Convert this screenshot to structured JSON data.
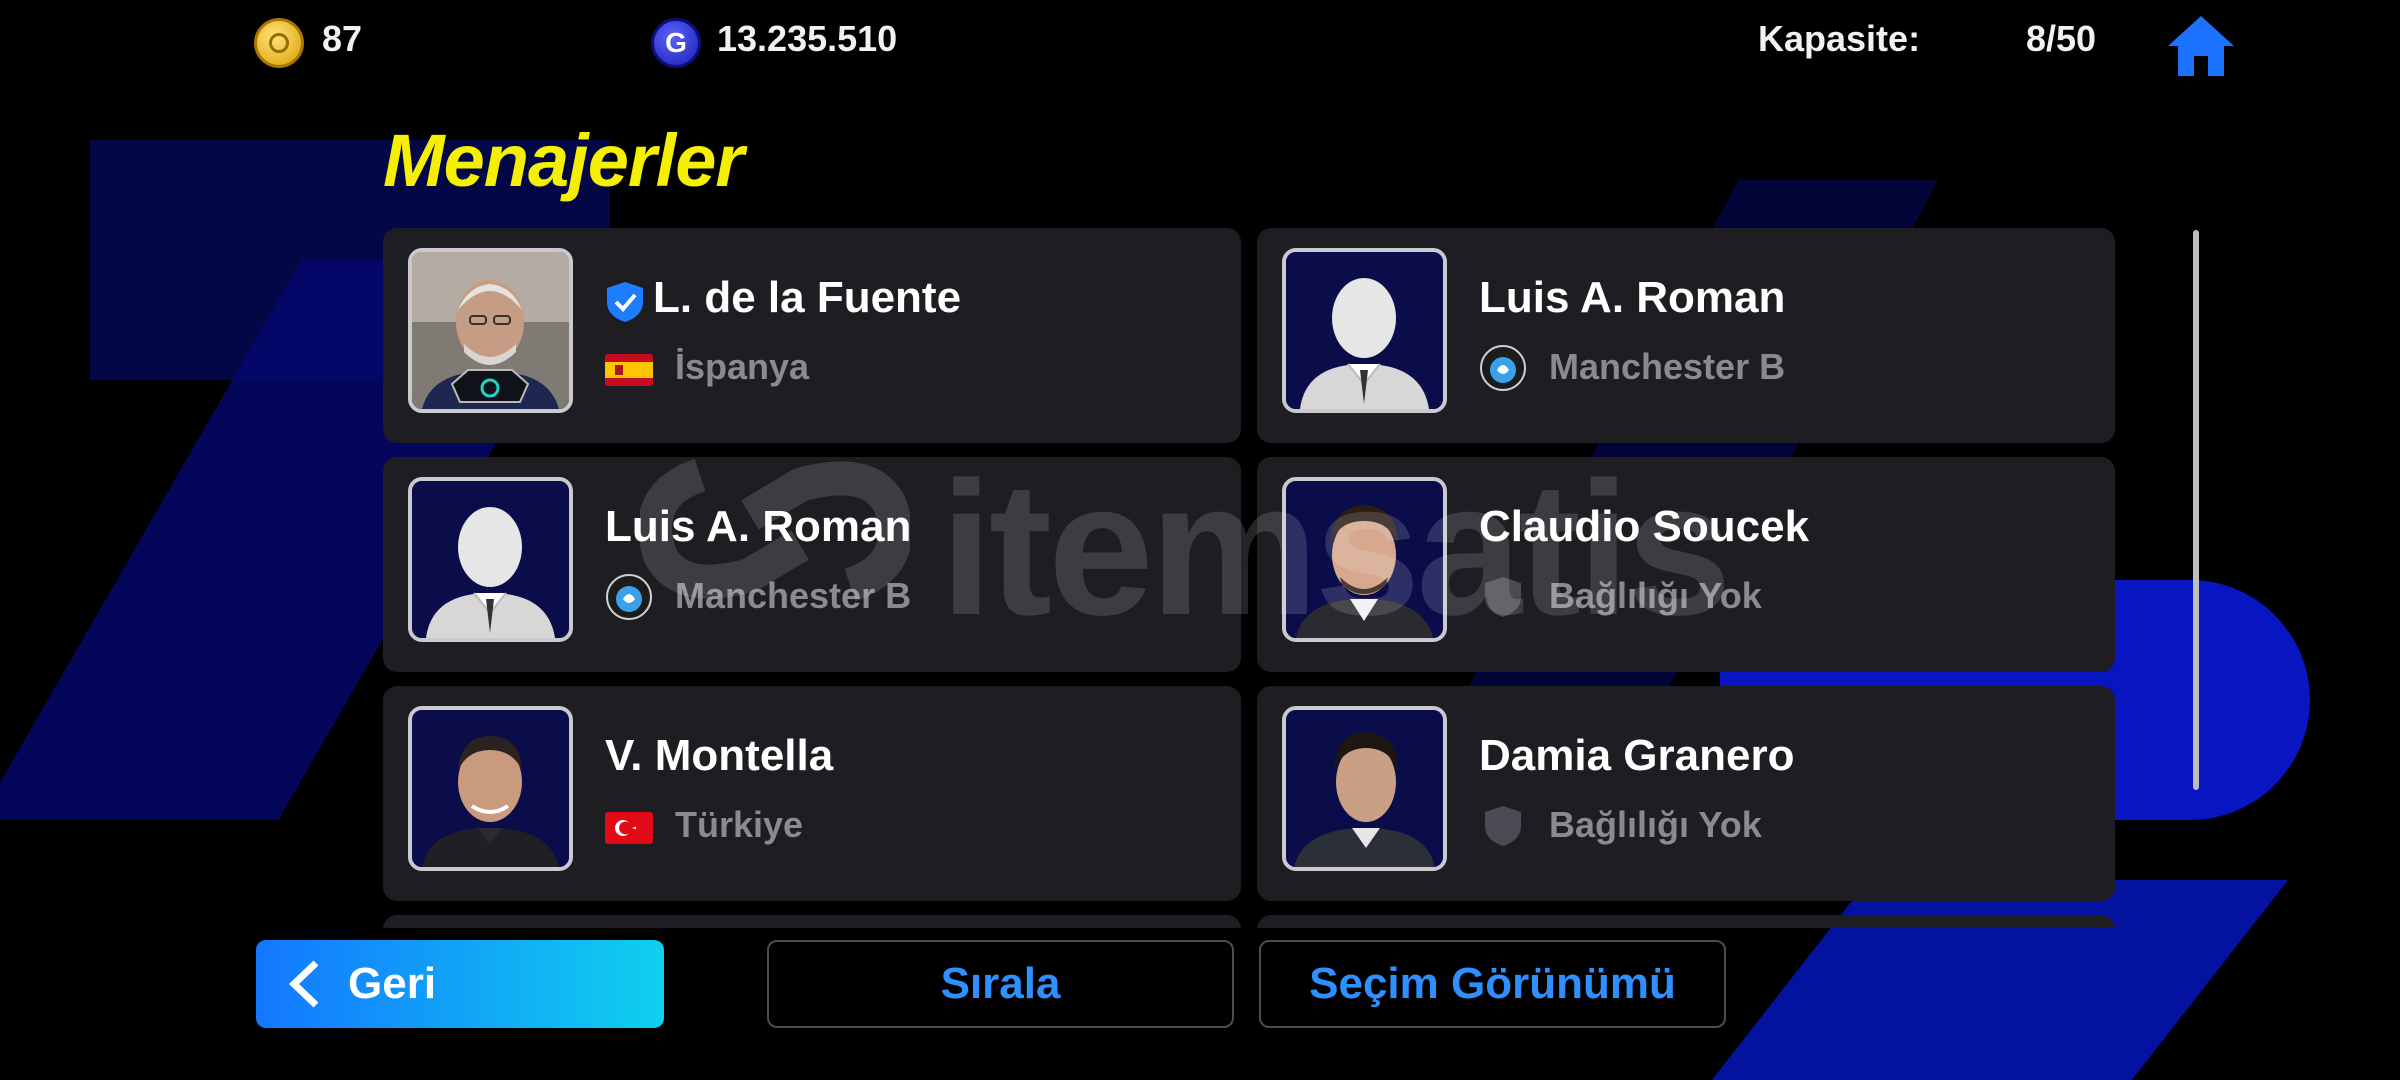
{
  "topbar": {
    "coins": "87",
    "gp": "13.235.510",
    "gp_symbol": "G",
    "capacity_label": "Kapasite:",
    "capacity_value": "8/50",
    "home_icon": "home-icon"
  },
  "page": {
    "title": "Menajerler"
  },
  "managers": [
    {
      "name": "L. de la Fuente",
      "subtitle": "İspanya",
      "verified": true,
      "affiliation_icon": "spain-flag",
      "portrait": "real-photo-gray-hair"
    },
    {
      "name": "Luis A. Roman",
      "subtitle": "Manchester B",
      "verified": false,
      "affiliation_icon": "club-badge",
      "portrait": "silhouette"
    },
    {
      "name": "Luis A. Roman",
      "subtitle": "Manchester B",
      "verified": false,
      "affiliation_icon": "club-badge",
      "portrait": "silhouette"
    },
    {
      "name": "Claudio Soucek",
      "subtitle": "Bağlılığı Yok",
      "verified": false,
      "affiliation_icon": "shield-icon",
      "portrait": "real-photo-dark-hair"
    },
    {
      "name": "V. Montella",
      "subtitle": "Türkiye",
      "verified": false,
      "affiliation_icon": "turkey-flag",
      "portrait": "real-photo-smiling"
    },
    {
      "name": "Damia Granero",
      "subtitle": "Bağlılığı Yok",
      "verified": false,
      "affiliation_icon": "shield-icon",
      "portrait": "real-photo-dark-hair"
    }
  ],
  "buttons": {
    "back": "Geri",
    "sort": "Sırala",
    "selection_view": "Seçim Görünümü"
  },
  "colors": {
    "title": "#f5ef00",
    "accent_blue": "#2e8fff",
    "card_bg": "#1d1d22",
    "back_gradient_start": "#1377ff",
    "back_gradient_end": "#0fd0ee"
  },
  "watermark": "itemsatis"
}
